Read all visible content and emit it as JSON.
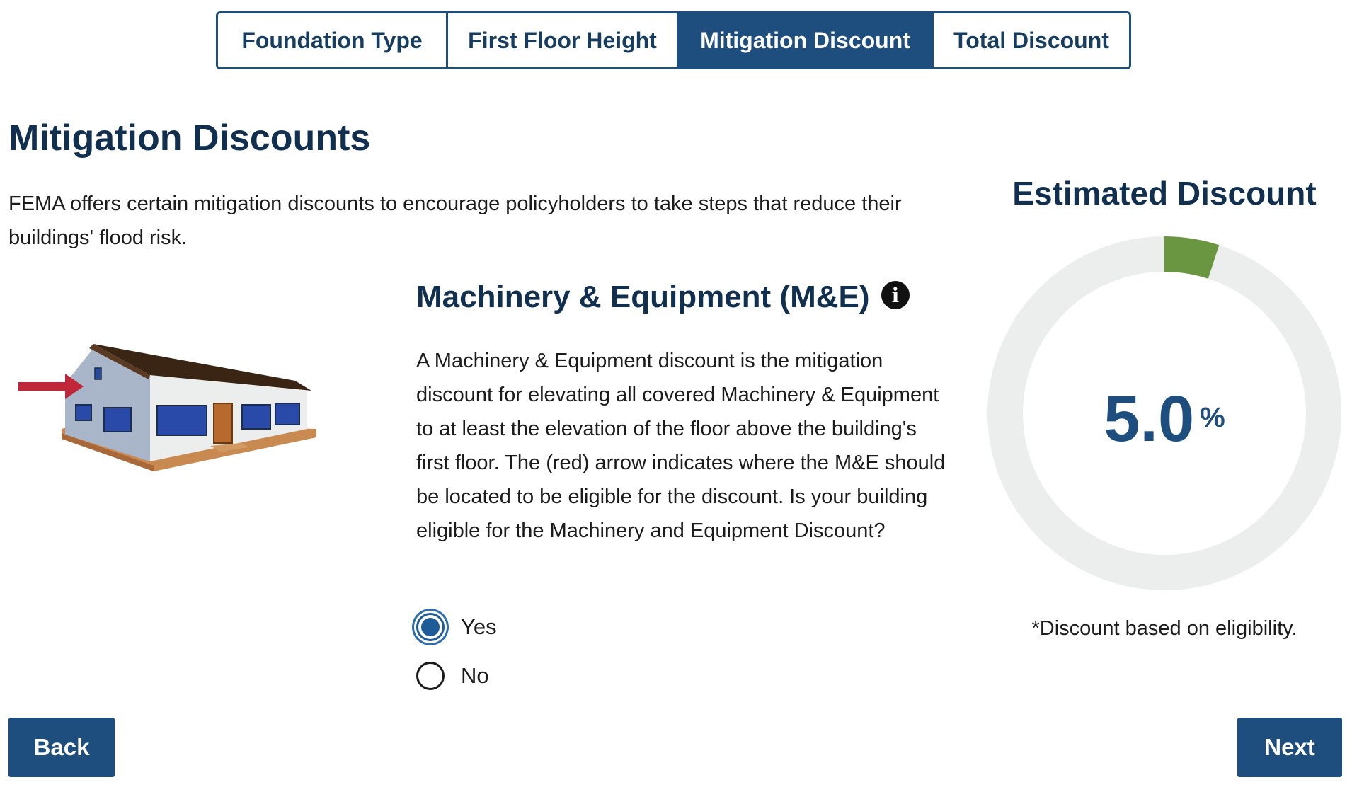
{
  "tabs": [
    {
      "label": "Foundation Type",
      "active": false
    },
    {
      "label": "First Floor Height",
      "active": false
    },
    {
      "label": "Mitigation Discount",
      "active": true
    },
    {
      "label": "Total Discount",
      "active": false
    }
  ],
  "page": {
    "title": "Mitigation Discounts",
    "intro": "FEMA offers certain mitigation discounts to encourage policyholders to take steps that reduce their buildings' flood risk."
  },
  "section": {
    "title": "Machinery & Equipment (M&E)",
    "info_icon": "info-icon",
    "info_glyph": "i",
    "description": "A Machinery & Equipment discount is the mitigation discount for elevating all covered Machinery & Equipment to at least the elevation of the floor above the building's first floor. The (red) arrow indicates where the M&E should be located to be eligible for the discount. Is your building eligible for the Machinery and Equipment Discount?",
    "options": [
      {
        "label": "Yes",
        "selected": true
      },
      {
        "label": "No",
        "selected": false
      }
    ]
  },
  "estimate": {
    "title": "Estimated Discount",
    "value": "5.0",
    "unit": "%",
    "fraction": 0.05,
    "footnote": "*Discount based on eligibility."
  },
  "colors": {
    "primary": "#1d4e7e",
    "heading": "#112f4e",
    "donut_track": "#eceeed",
    "donut_fill": "#6b9641",
    "arrow": "#c0283a"
  },
  "buttons": {
    "back": "Back",
    "next": "Next"
  }
}
